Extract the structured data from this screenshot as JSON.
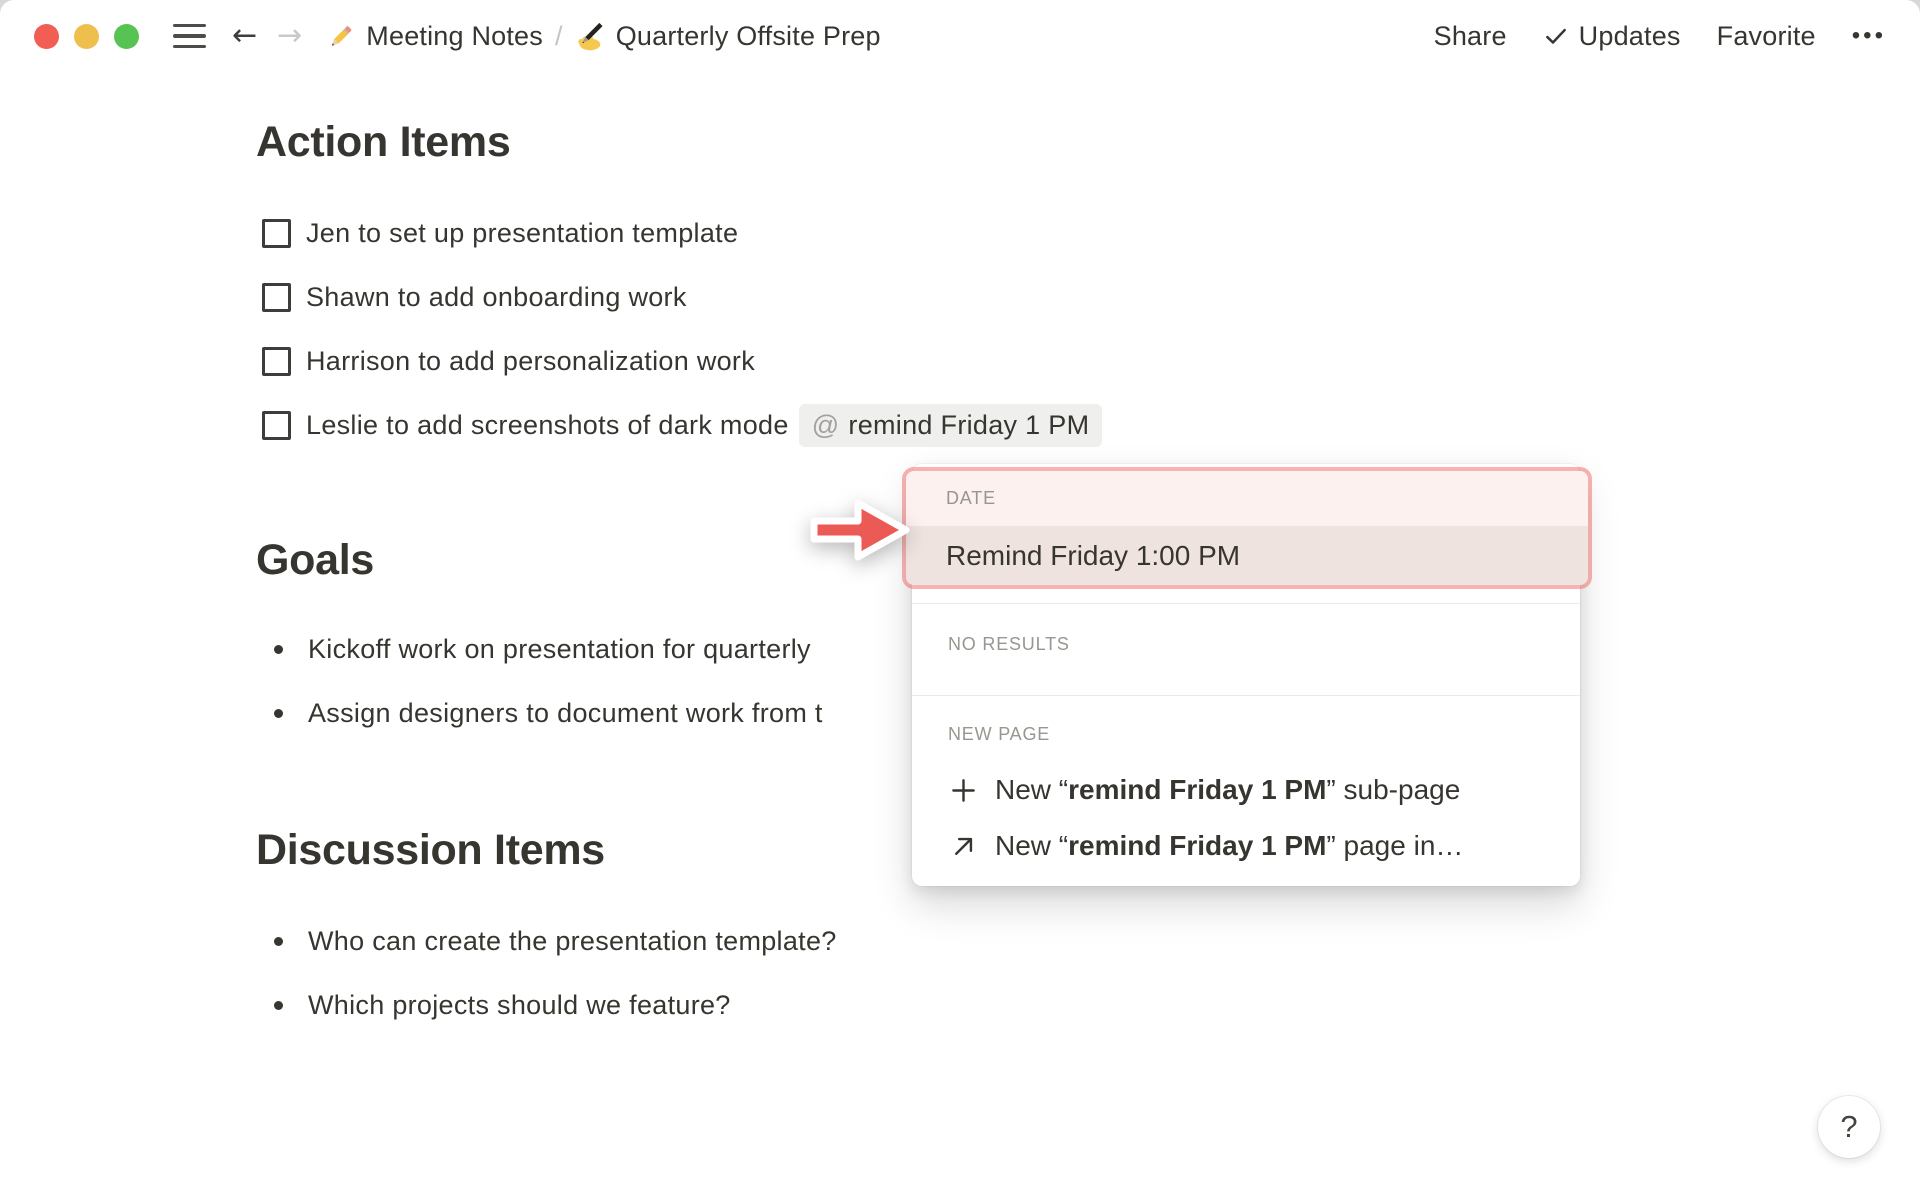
{
  "header": {
    "breadcrumb": {
      "page1_icon": "pencil-emoji",
      "page1": "Meeting Notes",
      "separator": "/",
      "page2_icon": "writing-hand-emoji",
      "page2": "Quarterly Offsite Prep"
    },
    "share": "Share",
    "updates": "Updates",
    "favorite": "Favorite",
    "more": "•••",
    "back_arrow": "←",
    "forward_arrow": "→"
  },
  "document": {
    "action_items": {
      "title": "Action Items",
      "todos": [
        {
          "label": "Jen to set up presentation template",
          "checked": false
        },
        {
          "label": "Shawn to add onboarding work",
          "checked": false
        },
        {
          "label": "Harrison to add personalization work",
          "checked": false
        },
        {
          "label": "Leslie to add screenshots of dark mode",
          "checked": false
        }
      ],
      "reminder_token": {
        "at_symbol": "@",
        "text": "remind Friday 1 PM"
      }
    },
    "goals": {
      "title": "Goals",
      "bullets": [
        "Kickoff work on presentation for quarterly",
        "Assign designers to document work from t"
      ]
    },
    "discussion_items": {
      "title": "Discussion Items",
      "bullets": [
        "Who can create the presentation template?",
        "Which projects should we feature?"
      ]
    }
  },
  "popup": {
    "date_section_label": "DATE",
    "date_option": "Remind Friday 1:00 PM",
    "no_results_label": "NO RESULTS",
    "new_page_label": "NEW PAGE",
    "options": [
      {
        "icon": "plus-icon",
        "prefix": "New “",
        "bold": "remind Friday 1 PM",
        "suffix": "” sub-page"
      },
      {
        "icon": "arrow-up-right-icon",
        "prefix": "New “",
        "bold": "remind Friday 1 PM",
        "suffix": "” page in…"
      }
    ]
  },
  "help_button": {
    "label": "?"
  },
  "colors": {
    "text": "#37352F",
    "accent_red_arrow": "#EC5A55",
    "highlight_ring": "#F1A7A1",
    "date_header_bg": "#FCF1EF",
    "date_selected_row_bg": "#EFE3E0",
    "token_bg": "#EFEFED",
    "traffic_red": "#F25D54",
    "traffic_yellow": "#EEBF4D",
    "traffic_green": "#57C353"
  }
}
